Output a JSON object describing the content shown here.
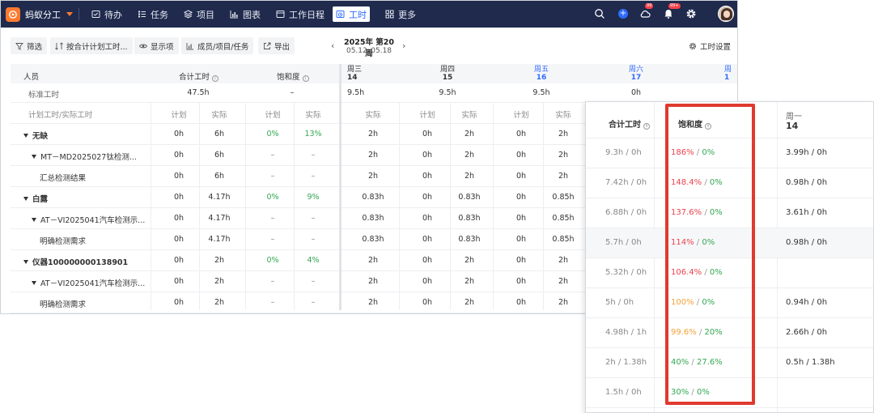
{
  "app": {
    "brand": "蚂蚁分工",
    "nav": [
      {
        "label": "待办",
        "icon": "todo-icon"
      },
      {
        "label": "任务",
        "icon": "task-icon"
      },
      {
        "label": "项目",
        "icon": "project-icon"
      },
      {
        "label": "图表",
        "icon": "chart-icon"
      },
      {
        "label": "工作日程",
        "icon": "calendar-icon"
      },
      {
        "label": "工时",
        "icon": "worktime-icon",
        "active": true
      },
      {
        "label": "更多",
        "icon": "grid-icon"
      }
    ],
    "badges": {
      "sync": "99",
      "bell": "99+"
    },
    "accent": "#2f6bff",
    "nav_bg": "#1f2a4d",
    "brand_color": "#ff7a2e"
  },
  "toolbar": {
    "filter": "筛选",
    "group_by": "按合计计划工时...",
    "display": "显示项",
    "dimension": "成员/项目/任务",
    "export": "导出",
    "week_title": "2025年 第20周",
    "week_range": "05.12–05.18",
    "settings": "工时设置"
  },
  "table": {
    "col_person": "人员",
    "col_total": "合计工时",
    "col_saturation": "饱和度",
    "days": [
      {
        "name": "周三",
        "date": "14",
        "weekend": false
      },
      {
        "name": "周四",
        "date": "15",
        "weekend": false
      },
      {
        "name": "周五",
        "date": "16",
        "weekend": true
      },
      {
        "name": "周六",
        "date": "17",
        "weekend": true
      },
      {
        "name": "周",
        "date": "1",
        "weekend": true
      }
    ],
    "standard_label": "标准工时",
    "standard": {
      "total": "47.5h",
      "saturation": "–",
      "days": [
        "9.5h",
        "9.5h",
        "9.5h",
        "0h"
      ]
    },
    "subheader_label": "计划工时/实际工时",
    "plan": "计划",
    "actual": "实际",
    "rows": [
      {
        "name": "无缺",
        "level": 0,
        "expand": true,
        "cells": [
          "0h",
          "6h",
          "0%",
          "13%",
          "2h",
          "0h",
          "2h",
          "0h",
          "2h"
        ]
      },
      {
        "name": "MT－MD2025027钛检测...",
        "level": 1,
        "expand": true,
        "cells": [
          "0h",
          "6h",
          "–",
          "–",
          "2h",
          "0h",
          "2h",
          "0h",
          "2h"
        ]
      },
      {
        "name": "汇总检测结果",
        "level": 2,
        "expand": false,
        "cells": [
          "0h",
          "6h",
          "–",
          "–",
          "2h",
          "0h",
          "2h",
          "0h",
          "2h"
        ]
      },
      {
        "name": "白露",
        "level": 0,
        "expand": true,
        "cells": [
          "0h",
          "4.17h",
          "0%",
          "9%",
          "0.83h",
          "0h",
          "0.83h",
          "0h",
          "0.85h"
        ]
      },
      {
        "name": "AT－VI2025041汽车检测示...",
        "level": 1,
        "expand": true,
        "cells": [
          "0h",
          "4.17h",
          "–",
          "–",
          "0.83h",
          "0h",
          "0.83h",
          "0h",
          "0.85h"
        ]
      },
      {
        "name": "明确检测需求",
        "level": 2,
        "expand": false,
        "cells": [
          "0h",
          "4.17h",
          "–",
          "–",
          "0.83h",
          "0h",
          "0.83h",
          "0h",
          "0.85h"
        ]
      },
      {
        "name": "仪器100000000138901",
        "level": 0,
        "expand": true,
        "cells": [
          "0h",
          "2h",
          "0%",
          "4%",
          "2h",
          "0h",
          "2h",
          "0h",
          "2h"
        ]
      },
      {
        "name": "AT－VI2025041汽车检测示...",
        "level": 1,
        "expand": true,
        "cells": [
          "0h",
          "2h",
          "–",
          "–",
          "2h",
          "0h",
          "2h",
          "0h",
          "2h"
        ]
      },
      {
        "name": "明确检测需求",
        "level": 2,
        "expand": false,
        "cells": [
          "0h",
          "2h",
          "–",
          "–",
          "2h",
          "0h",
          "2h",
          "0h",
          "2h"
        ]
      }
    ]
  },
  "zoom": {
    "col_total": "合计工时",
    "col_saturation": "饱和度",
    "col_day_name": "周一",
    "col_day_date": "14",
    "rows": [
      {
        "total": "9.3h / 0h",
        "plan_sat": "186%",
        "plan_color": "red",
        "actual_sat": "0%",
        "day": "3.99h / 0h"
      },
      {
        "total": "7.42h / 0h",
        "plan_sat": "148.4%",
        "plan_color": "red",
        "actual_sat": "0%",
        "day": "0.98h / 0h"
      },
      {
        "total": "6.88h / 0h",
        "plan_sat": "137.6%",
        "plan_color": "red",
        "actual_sat": "0%",
        "day": "3.61h / 0h"
      },
      {
        "total": "5.7h / 0h",
        "plan_sat": "114%",
        "plan_color": "red",
        "actual_sat": "0%",
        "day": "0.98h / 0h"
      },
      {
        "total": "5.32h / 0h",
        "plan_sat": "106.4%",
        "plan_color": "red",
        "actual_sat": "0%",
        "day": ""
      },
      {
        "total": "5h / 0h",
        "plan_sat": "100%",
        "plan_color": "orange",
        "actual_sat": "0%",
        "day": "0.94h / 0h"
      },
      {
        "total": "4.98h / 1h",
        "plan_sat": "99.6%",
        "plan_color": "orange",
        "actual_sat": "20%",
        "day": "2.66h / 0h"
      },
      {
        "total": "2h / 1.38h",
        "plan_sat": "40%",
        "plan_color": "green",
        "actual_sat": "27.6%",
        "day": "0.5h / 1.38h"
      },
      {
        "total": "1.5h / 0h",
        "plan_sat": "30%",
        "plan_color": "green",
        "actual_sat": "0%",
        "day": ""
      }
    ],
    "colors": {
      "red": "#e8434e",
      "orange": "#f2a23a",
      "green": "#34a853",
      "highlight": "#e03a2f"
    }
  }
}
